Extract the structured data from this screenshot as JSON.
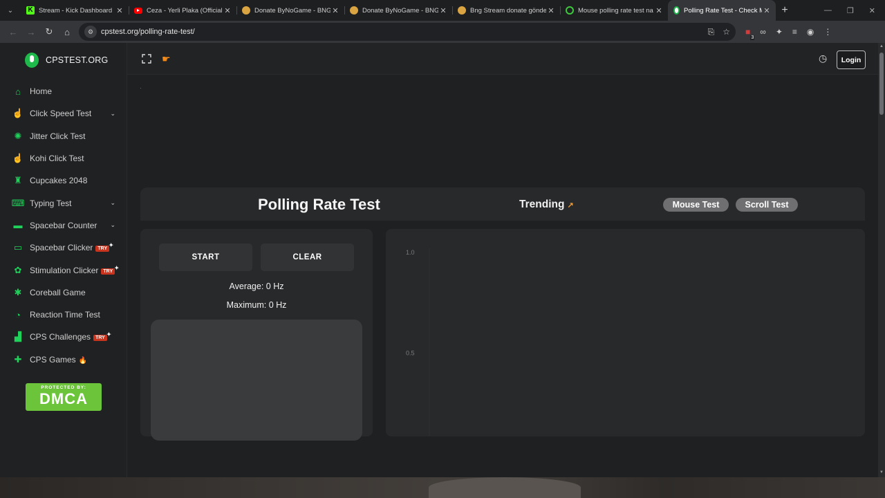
{
  "browser": {
    "tabs": [
      {
        "title": "Stream - Kick Dashboard",
        "icon": "kick-icon"
      },
      {
        "title": "Ceza - Yerli Plaka (Official V",
        "icon": "youtube-icon"
      },
      {
        "title": "Donate ByNoGame - BNG",
        "icon": "bng-icon"
      },
      {
        "title": "Donate ByNoGame - BNG",
        "icon": "bng-icon"
      },
      {
        "title": "Bng Stream donate gönde",
        "icon": "bng-icon"
      },
      {
        "title": "Mouse polling rate test na",
        "icon": "power-icon"
      },
      {
        "title": "Polling Rate Test - Check M",
        "icon": "cpstest-icon"
      }
    ],
    "close_glyph": "✕",
    "new_tab_glyph": "+",
    "url": "cpstest.org/polling-rate-test/",
    "extension_badge": "3"
  },
  "site": {
    "brand": "CPSTEST.ORG",
    "login_label": "Login",
    "nav": [
      {
        "label": "Home",
        "icon": "home-icon",
        "glyph": "⌂",
        "chevron": false
      },
      {
        "label": "Click Speed Test",
        "icon": "click-icon",
        "glyph": "☝",
        "chevron": true
      },
      {
        "label": "Jitter Click Test",
        "icon": "jitter-icon",
        "glyph": "✺",
        "chevron": false
      },
      {
        "label": "Kohi Click Test",
        "icon": "kohi-icon",
        "glyph": "☝",
        "chevron": false
      },
      {
        "label": "Cupcakes 2048",
        "icon": "cupcake-icon",
        "glyph": "♜",
        "chevron": false
      },
      {
        "label": "Typing Test",
        "icon": "keyboard-icon",
        "glyph": "⌨",
        "chevron": true
      },
      {
        "label": "Spacebar Counter",
        "icon": "spacebar-icon",
        "glyph": "▬",
        "chevron": true
      },
      {
        "label": "Spacebar Clicker",
        "icon": "spacebar-clicker-icon",
        "glyph": "▭",
        "chevron": false,
        "badge": "TRY"
      },
      {
        "label": "Stimulation Clicker",
        "icon": "stimulation-icon",
        "glyph": "✿",
        "chevron": false,
        "badge": "TRY"
      },
      {
        "label": "Coreball Game",
        "icon": "coreball-icon",
        "glyph": "✱",
        "chevron": false
      },
      {
        "label": "Reaction Time Test",
        "icon": "timer-icon",
        "glyph": "◔",
        "chevron": false
      },
      {
        "label": "CPS Challenges",
        "icon": "challenge-icon",
        "glyph": "▟",
        "chevron": false,
        "badge": "TRY"
      },
      {
        "label": "CPS Games",
        "icon": "gamepad-icon",
        "glyph": "✚",
        "chevron": false,
        "fire": true
      }
    ],
    "dmca": {
      "top": "PROTECTED BY:",
      "main": "DMCA"
    }
  },
  "main": {
    "title": "Polling Rate Test",
    "trending": "Trending",
    "pills": [
      "Mouse Test",
      "Scroll Test"
    ],
    "start_label": "START",
    "clear_label": "CLEAR",
    "average": "Average: 0 Hz",
    "maximum": "Maximum: 0 Hz"
  },
  "chart_data": {
    "type": "line",
    "title": "",
    "xlabel": "",
    "ylabel": "",
    "ylim": [
      0,
      1.0
    ],
    "yticks": [
      "1.0",
      "0.5"
    ],
    "series": [],
    "grid": false
  },
  "colors": {
    "accent": "#1fd15a",
    "try_badge": "#c8341e",
    "trend_arrow": "#f29a2e",
    "dmca": "#6bc43a"
  }
}
